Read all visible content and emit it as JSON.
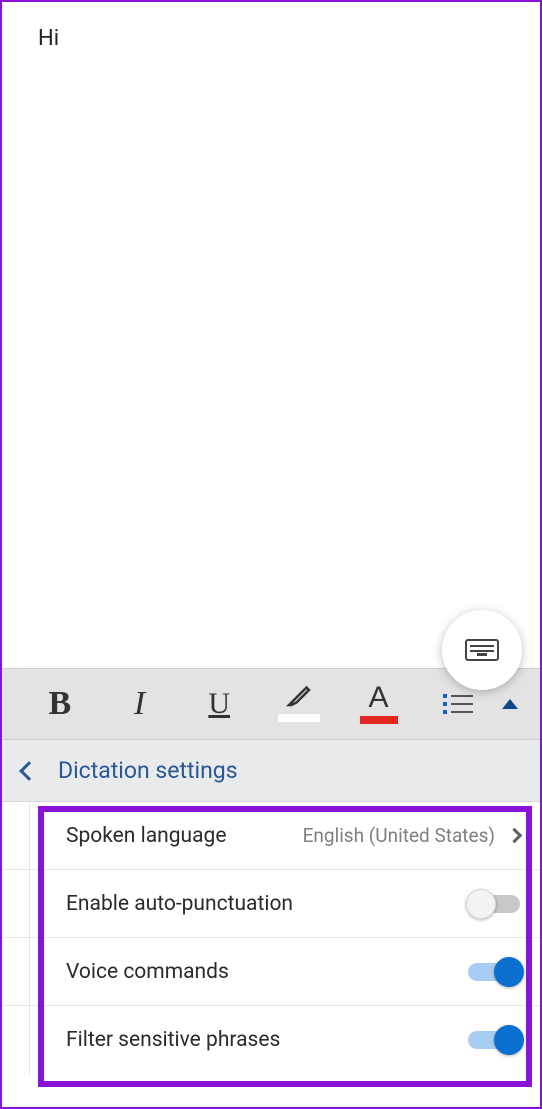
{
  "document": {
    "body_text": "Hi"
  },
  "fab": {
    "icon": "keyboard-icon"
  },
  "toolbar": {
    "bold_label": "B",
    "italic_label": "I",
    "underline_label": "U",
    "font_color_letter": "A",
    "highlight_color": "#ffffff",
    "font_color": "#e2261f",
    "list_accent": "#1565c0"
  },
  "panel": {
    "title": "Dictation settings"
  },
  "settings": {
    "spoken_language": {
      "label": "Spoken language",
      "value": "English (United States)"
    },
    "auto_punctuation": {
      "label": "Enable auto-punctuation",
      "enabled": false
    },
    "voice_commands": {
      "label": "Voice commands",
      "enabled": true
    },
    "filter_sensitive": {
      "label": "Filter sensitive phrases",
      "enabled": true
    }
  }
}
